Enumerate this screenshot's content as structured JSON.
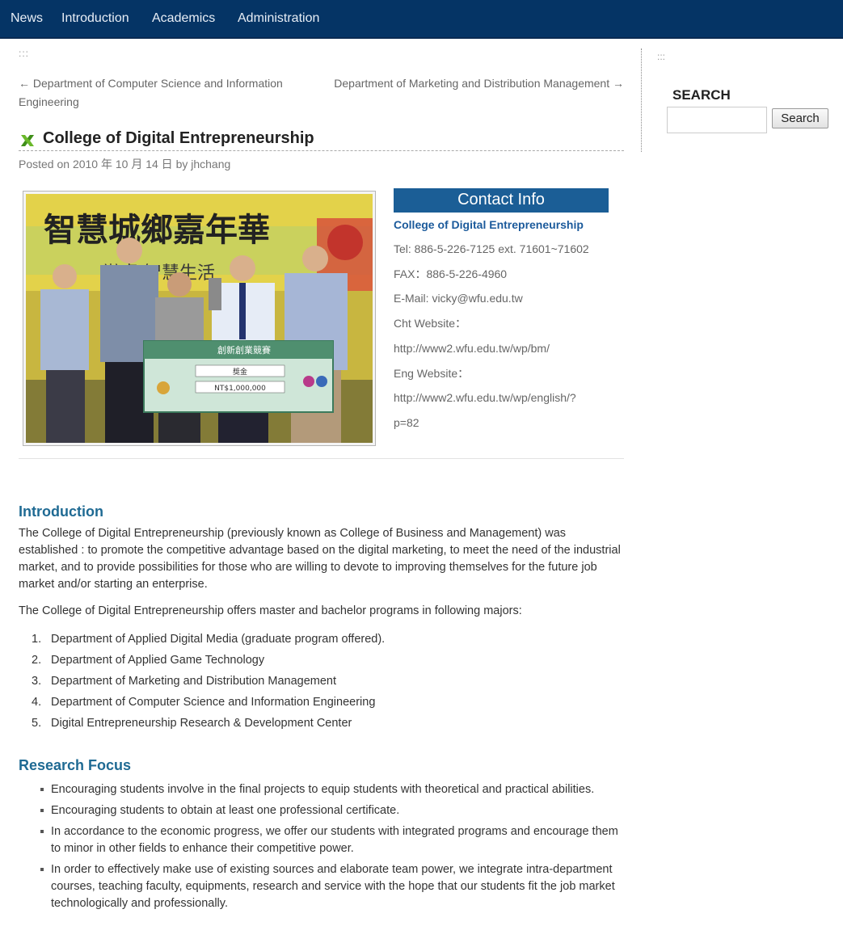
{
  "nav": {
    "items": [
      "News",
      "Introduction",
      "Academics",
      "Administration"
    ]
  },
  "post_nav": {
    "dots": ":::",
    "prev": "← Department of Computer Science and Information Engineering",
    "next": "Department of Marketing and Distribution Management →"
  },
  "post": {
    "title": "College of Digital Entrepreneurship",
    "meta": "Posted on 2010 年 10 月 14 日 by jhchang"
  },
  "photo": {
    "banner_text": "智慧城鄉嘉年華",
    "sub_text": "辦桌  智慧生活",
    "board_header": "創新創業競賽",
    "board_amount": "NT$1,000,000",
    "board_label": "獎金"
  },
  "contact": {
    "heading": "Contact Info",
    "org": "College of Digital Entrepreneurship",
    "tel": "Tel: 886-5-226-7125 ext. 71601~71602",
    "fax": "FAX：886-5-226-4960",
    "email": "E-Mail: vicky@wfu.edu.tw",
    "cht_label": "Cht Website：",
    "cht_url": "http://www2.wfu.edu.tw/wp/bm/",
    "eng_label": "Eng Website：",
    "eng_url_1": "http://www2.wfu.edu.tw/wp/english/?",
    "eng_url_2": "p=82"
  },
  "intro": {
    "heading": "Introduction",
    "p1": "The College of Digital Entrepreneurship (previously known as College of Business and Management) was established : to promote the competitive advantage based on the digital marketing, to meet the need of the industrial market, and to provide possibilities for those who are willing to devote to improving themselves for the future job market and/or starting an enterprise.",
    "p2": "The College of Digital Entrepreneurship offers master and bachelor programs in following majors:",
    "majors": [
      {
        "num": "1.",
        "text": "Department of Applied Digital Media (graduate program offered)."
      },
      {
        "num": "2.",
        "text": "Department of Applied Game Technology"
      },
      {
        "num": "3.",
        "text": "Department of Marketing and Distribution Management"
      },
      {
        "num": "4.",
        "text": "Department of Computer Science and Information Engineering"
      },
      {
        "num": "5.",
        "text": "Digital Entrepreneurship Research & Development Center"
      }
    ]
  },
  "research": {
    "heading": "Research Focus",
    "items": [
      "Encouraging students involve in the final projects to equip students with theoretical and practical abilities.",
      "Encouraging students to obtain at least one professional certificate.",
      "In accordance to the economic progress, we offer our students with integrated programs and encourage them to minor in other fields to enhance their competitive power.",
      "In order to effectively make use of existing sources and elaborate team power, we integrate intra-department courses, teaching faculty, equipments, research and service with the hope that our students fit the job market technologically and professionally."
    ]
  },
  "sidebar": {
    "dots": ":::",
    "search_title": "SEARCH",
    "search_button": "Search",
    "search_value": ""
  },
  "colors": {
    "nav_bg": "#053465",
    "contact_head_bg": "#1b5e96",
    "section_heading": "#1f6a93",
    "link_blue": "#1b5a9b"
  },
  "icons": {
    "title_icon": "green-cross-icon"
  }
}
